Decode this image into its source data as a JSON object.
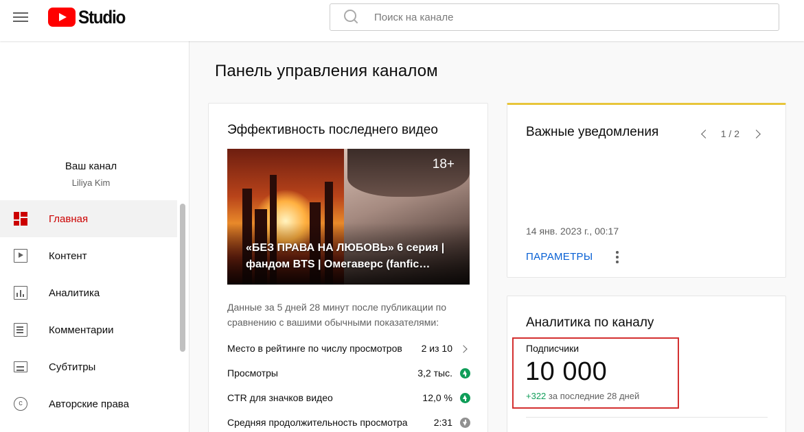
{
  "header": {
    "logo_text": "Studio",
    "search_placeholder": "Поиск на канале"
  },
  "sidebar": {
    "channel_title": "Ваш канал",
    "channel_name": "Liliya Kim",
    "items": [
      {
        "label": "Главная",
        "icon": "dashboard-icon",
        "active": true
      },
      {
        "label": "Контент",
        "icon": "content-icon"
      },
      {
        "label": "Аналитика",
        "icon": "analytics-icon"
      },
      {
        "label": "Комментарии",
        "icon": "comments-icon"
      },
      {
        "label": "Субтитры",
        "icon": "subtitles-icon"
      },
      {
        "label": "Авторские права",
        "icon": "copyright-icon"
      }
    ],
    "active_color": "#cc0000"
  },
  "main": {
    "page_title": "Панель управления каналом",
    "latest_video": {
      "heading": "Эффективность последнего видео",
      "age_badge": "18+",
      "video_title": "«БЕЗ ПРАВА НА ЛЮБОВЬ» 6 серия | фандом BTS | Омегаверс (fanfic…",
      "period_text": "Данные за 5 дней 28 минут после публикации по сравнению с вашими обычными показателями:",
      "stats": [
        {
          "label": "Место в рейтинге по числу просмотров",
          "value": "2 из 10",
          "indicator": "chevron-right-icon"
        },
        {
          "label": "Просмотры",
          "value": "3,2 тыс.",
          "indicator": "arrow-up-icon"
        },
        {
          "label": "CTR для значков видео",
          "value": "12,0 %",
          "indicator": "arrow-up-icon"
        },
        {
          "label": "Средняя продолжительность просмотра",
          "value": "2:31",
          "indicator": "arrow-down-icon"
        }
      ]
    },
    "notifications": {
      "heading": "Важные уведомления",
      "pager": "1 / 2",
      "date": "14 янв. 2023 г., 00:17",
      "action_label": "ПАРАМЕТРЫ",
      "accent_color": "#e8c53a"
    },
    "analytics": {
      "heading": "Аналитика по каналу",
      "subscribers_label": "Подписчики",
      "subscribers_value": "10 000",
      "subscribers_delta": "+322",
      "subscribers_period": "за последние 28 дней",
      "highlight_color": "#d32f2f"
    }
  }
}
